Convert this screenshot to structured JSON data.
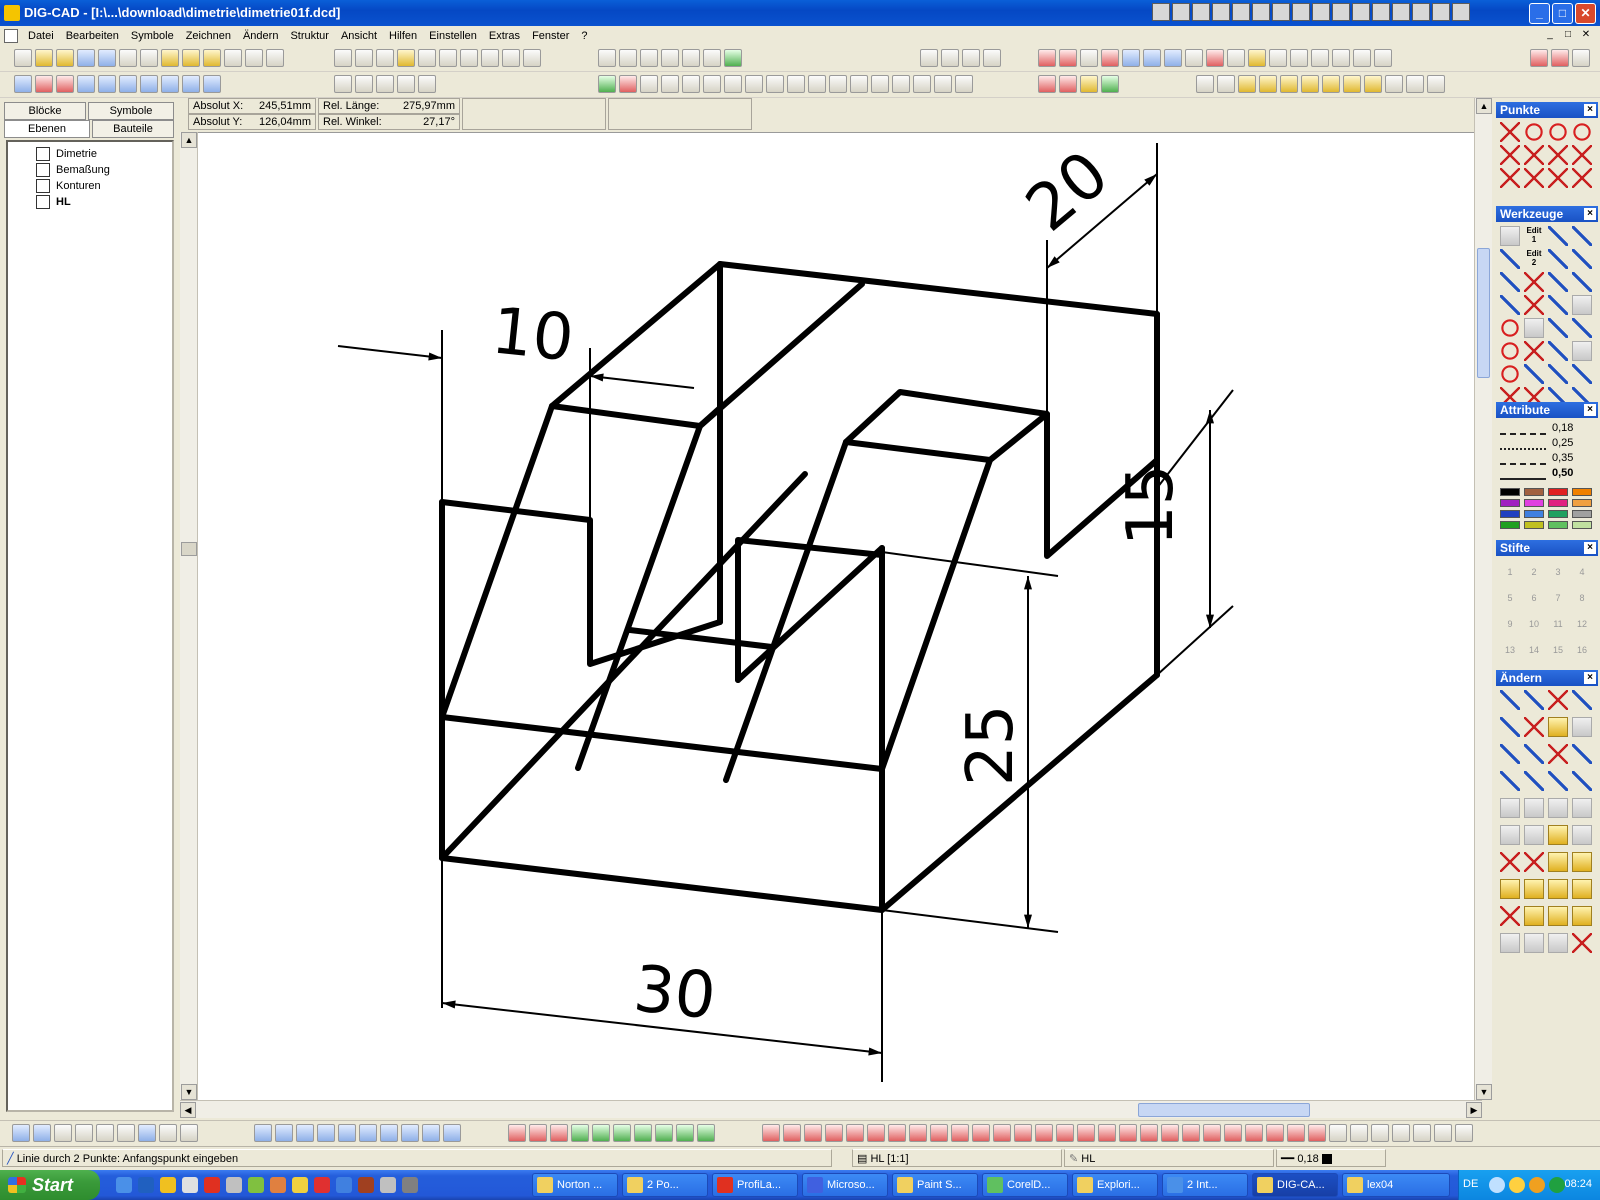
{
  "window": {
    "title": "DIG-CAD - [I:\\...\\download\\dimetrie\\dimetrie01f.dcd]",
    "min_label": "_",
    "max_label": "□",
    "close_label": "✕"
  },
  "menu": [
    "Datei",
    "Bearbeiten",
    "Symbole",
    "Zeichnen",
    "Ändern",
    "Struktur",
    "Ansicht",
    "Hilfen",
    "Einstellen",
    "Extras",
    "Fenster",
    "?"
  ],
  "panel_tabs": {
    "bloecke": "Blöcke",
    "symbole": "Symbole",
    "ebenen": "Ebenen",
    "bauteile": "Bauteile"
  },
  "layers": [
    "Dimetrie",
    "Bemaßung",
    "Konturen",
    "HL"
  ],
  "active_layer_index": 3,
  "coords": {
    "abs_x_label": "Absolut X:",
    "abs_x_value": "245,51mm",
    "abs_y_label": "Absolut Y:",
    "abs_y_value": "126,04mm",
    "rel_len_label": "Rel. Länge:",
    "rel_len_value": "275,97mm",
    "rel_angle_label": "Rel. Winkel:",
    "rel_angle_value": "27,17°"
  },
  "dimensions": {
    "d10": "10",
    "d20": "20",
    "d15": "15",
    "d25": "25",
    "d30": "30"
  },
  "palettes": {
    "punkte": "Punkte",
    "werkzeuge": "Werkzeuge",
    "attribute": "Attribute",
    "stifte": "Stifte",
    "aendern": "Ändern",
    "close": "×"
  },
  "line_widths": [
    "0,18",
    "0,25",
    "0,35",
    "0,50"
  ],
  "werkzeuge_labels": {
    "edit1": "Edit 1",
    "edit2": "Edit 2"
  },
  "swatch_colors": [
    "#000000",
    "#a06040",
    "#e02020",
    "#f08000",
    "#a020c0",
    "#e040e0",
    "#e02080",
    "#f0a040",
    "#2040c0",
    "#4080e0",
    "#20a060",
    "#a0a0a0",
    "#20a020",
    "#c0c020",
    "#60c060",
    "#c0e0a0"
  ],
  "stifte_labels": [
    "1",
    "2",
    "3",
    "4",
    "5",
    "6",
    "7",
    "8",
    "9",
    "10",
    "11",
    "12",
    "13",
    "14",
    "15",
    "16"
  ],
  "status": {
    "prompt": "Linie durch 2 Punkte: Anfangspunkt eingeben",
    "layer": "HL [1:1]",
    "pen": "HL",
    "width": "0,18"
  },
  "taskbar": {
    "start": "Start",
    "tasks": [
      "Norton ...",
      "2 Po...",
      "ProfiLa...",
      "Microso...",
      "Paint S...",
      "CorelD...",
      "Explori...",
      "2 Int...",
      "DIG-CA...",
      "lex04"
    ],
    "active_task_index": 8,
    "lang": "DE",
    "clock": "08:24"
  }
}
